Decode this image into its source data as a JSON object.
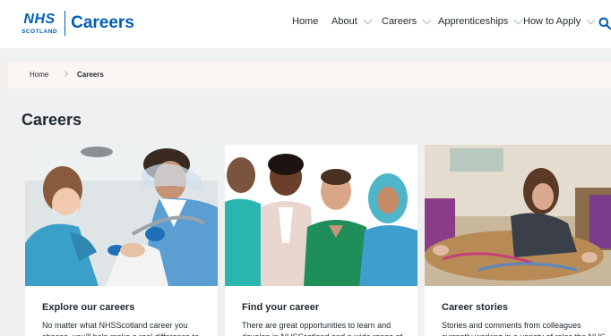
{
  "logo": {
    "nhs": "NHS",
    "scotland": "SCOTLAND",
    "site": "Careers"
  },
  "nav": {
    "items": [
      {
        "label": "Home"
      },
      {
        "label": "About"
      },
      {
        "label": "Careers"
      },
      {
        "label": "Apprenticeships"
      },
      {
        "label": "How to Apply"
      }
    ],
    "search_icon": "search-icon"
  },
  "breadcrumb": {
    "home": "Home",
    "current": "Careers"
  },
  "page_title": "Careers",
  "cards": [
    {
      "title": "Explore our careers",
      "text": "No matter what NHSScotland career you choose, you'll help make a real difference to"
    },
    {
      "title": "Find your career",
      "text": "There are great opportunities to learn and develop in NHSScotland and a wide range of"
    },
    {
      "title": "Career stories",
      "text": "Stories and comments from colleagues currently working in a variety of roles the NHS"
    }
  ],
  "colors": {
    "brand": "#005eb8",
    "text": "#212b32",
    "page_bg": "#f0f0f0",
    "crumb_bg": "#fbf5f4"
  }
}
